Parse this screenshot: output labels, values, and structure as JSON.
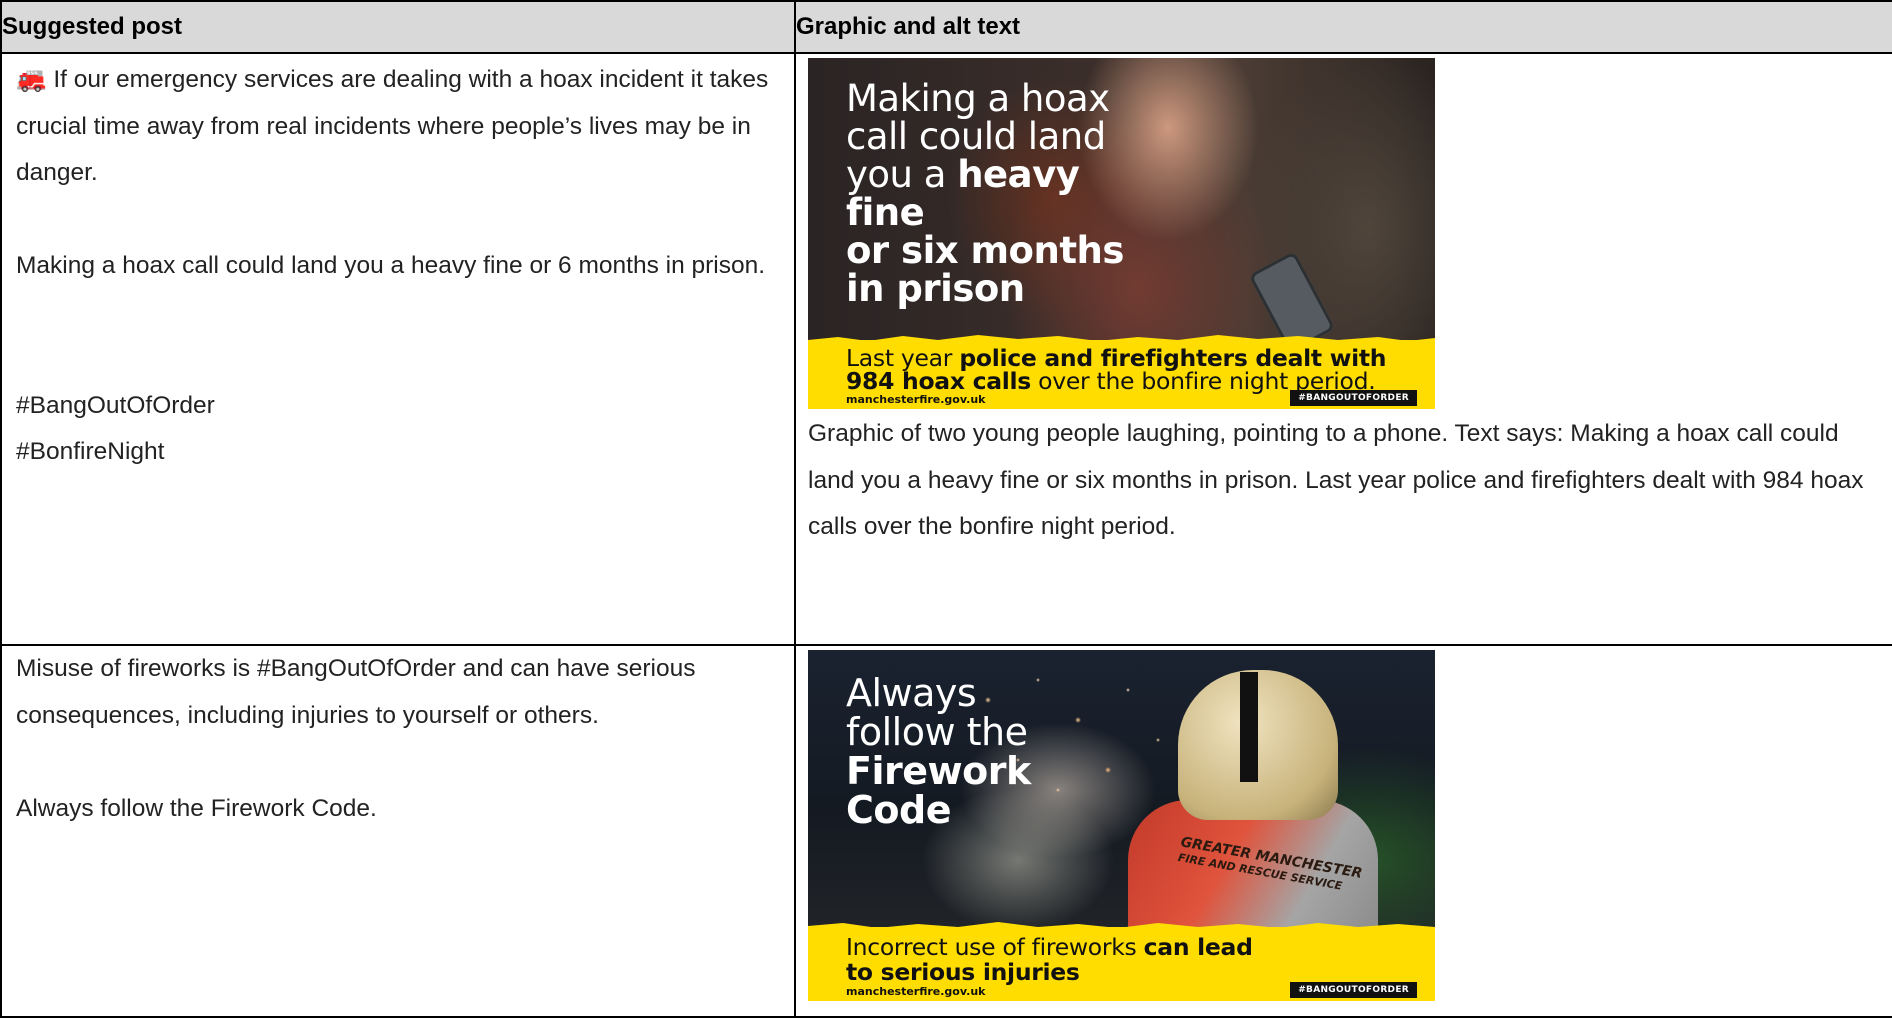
{
  "table": {
    "header": {
      "col_post": "Suggested post",
      "col_graphic": "Graphic and alt text"
    },
    "rows": [
      {
        "post": {
          "emoji": "🚒",
          "p1": "If our emergency services are dealing with a hoax incident it takes crucial time away from real incidents where people’s lives may be in danger.",
          "p2": "Making a hoax call could land you a heavy fine or 6 months in prison.",
          "hashtag1": "#BangOutOfOrder",
          "hashtag2": "#BonfireNight"
        },
        "graphic": {
          "headline_line1": "Making a hoax",
          "headline_line2": "call could land",
          "headline_line3_plain": "you a ",
          "headline_line3_bold": "heavy fine",
          "headline_line4": "or six months",
          "headline_line5": "in prison",
          "banner_line1_plain": "Last year ",
          "banner_line1_bold": "police and firefighters dealt with",
          "banner_line2_bold": "984 hoax calls",
          "banner_line2_plain": " over the bonfire night period.",
          "url": "manchesterfire.gov.uk",
          "tag": "#BANGOUTOFORDER"
        },
        "alt_text": "Graphic of two young people laughing, pointing to a phone. Text says: Making a hoax call could land you a heavy fine or six months in prison. Last year police and firefighters dealt with 984 hoax calls over the bonfire night period."
      },
      {
        "post": {
          "p1": "Misuse of fireworks is #BangOutOfOrder and can have serious consequences, including injuries to yourself or others.",
          "p2": "Always follow the Firework Code."
        },
        "graphic": {
          "headline_line1": "Always",
          "headline_line2": "follow the",
          "headline_line3": "Firework",
          "headline_line4": "Code",
          "jacket_line1": "GREATER MANCHESTER",
          "jacket_line2": "FIRE AND RESCUE SERVICE",
          "banner_line1_plain": "Incorrect use of fireworks ",
          "banner_line1_bold": "can lead",
          "banner_line2_bold": "to serious injuries",
          "url": "manchesterfire.gov.uk",
          "tag": "#BANGOUTOFORDER"
        }
      }
    ]
  },
  "colors": {
    "header_bg": "#d9d9d9",
    "banner_yellow": "#ffdd00",
    "border": "#000000"
  }
}
